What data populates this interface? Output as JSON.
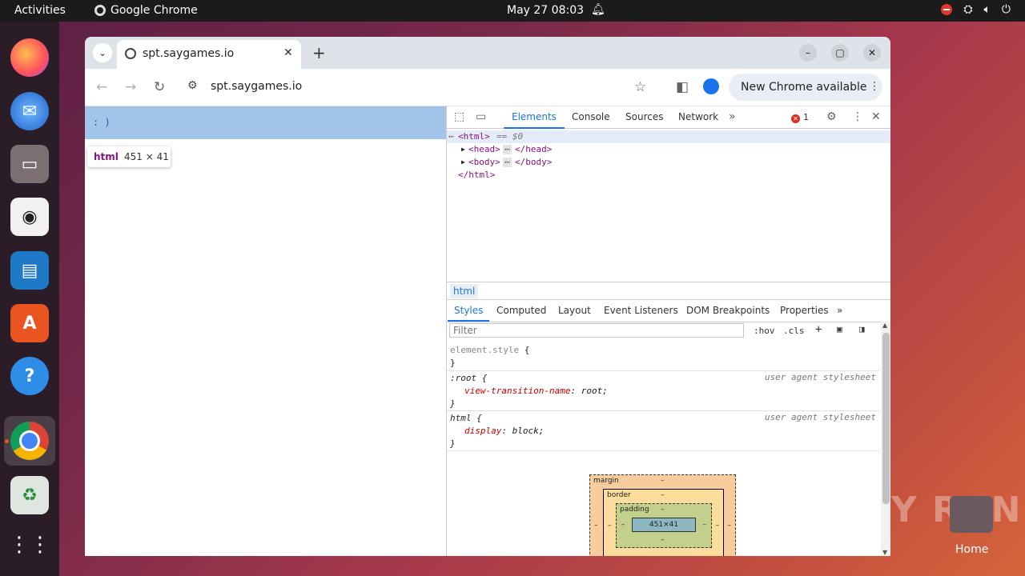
{
  "topbar": {
    "activities": "Activities",
    "app_name": "Google Chrome",
    "clock": "May 27  08:03"
  },
  "dock": {
    "items": [
      "Firefox",
      "Thunderbird",
      "Files",
      "Rhythmbox",
      "LibreOffice Writer",
      "App Center",
      "Help",
      "Google Chrome",
      "Trash",
      "Show Apps"
    ]
  },
  "watermark": {
    "text": "ANY RUN",
    "home_label": "Home"
  },
  "browser": {
    "tab_title": "spt.saygames.io",
    "url": "spt.saygames.io",
    "update_label": "New Chrome available"
  },
  "page": {
    "content_text": ": )",
    "tooltip_tag": "html",
    "tooltip_dims": "451 × 41"
  },
  "devtools": {
    "tabs": [
      "Elements",
      "Console",
      "Sources",
      "Network"
    ],
    "error_count": "1",
    "dom": {
      "html_open": "<html>",
      "eq0": "== $0",
      "head": "<head>",
      "head_close": "</head>",
      "body": "<body>",
      "body_close": "</body>",
      "html_close": "</html>"
    },
    "breadcrumb": "html",
    "subtabs": [
      "Styles",
      "Computed",
      "Layout",
      "Event Listeners",
      "DOM Breakpoints",
      "Properties"
    ],
    "filter_placeholder": "Filter",
    "hov": ":hov",
    "cls": ".cls",
    "rules": {
      "element_style": "element.style",
      "root_selector": ":root",
      "root_source": "user agent stylesheet",
      "root_prop": "view-transition-name",
      "root_val": "root;",
      "html_selector": "html",
      "html_source": "user agent stylesheet",
      "html_prop": "display",
      "html_val": "block;"
    },
    "box_model": {
      "margin": "margin",
      "border": "border",
      "padding": "padding",
      "content": "451×41",
      "dash": "–"
    }
  }
}
